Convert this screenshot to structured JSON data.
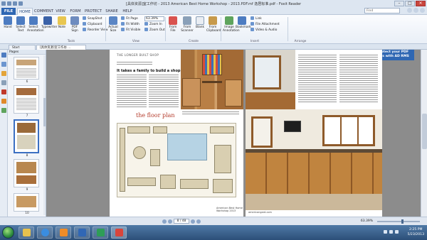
{
  "window": {
    "title": "[具体资源]室工作坊 - 2013 American Best Home Workshop - 2013.PDF.mf 逸居标准.pdf - Foxit Reader"
  },
  "menu": {
    "tabs": [
      "FILE",
      "HOME",
      "COMMENT",
      "VIEW",
      "FORM",
      "PROTECT",
      "SHARE",
      "HELP"
    ],
    "find_placeholder": "Find"
  },
  "ribbon": {
    "buttons": {
      "hand": "Hand",
      "select_text": "Select Text",
      "select_annotation": "Select Annotation",
      "typewriter": "Typewriter",
      "note": "Note",
      "pdf_sign": "PDF Sign",
      "actual_size": "Actual Size",
      "from_file": "From File",
      "from_scanner": "From Scanner",
      "blank": "Blank",
      "from_clipboard": "From Clipboard",
      "image_annotation": "Image Annotation",
      "bookmark": "Bookmark"
    },
    "small": {
      "snapshot": "SnapShot",
      "clipboard": "Clipboard",
      "reorder_view": "Reorder View",
      "fit_page": "Fit Page",
      "fit_width": "Fit Width",
      "fit_visible": "Fit Visible",
      "zoom_in": "Zoom In",
      "zoom_out": "Zoom Out",
      "rotate_left": "Rotate Left",
      "rotate_right": "Rotate Right",
      "link": "Link",
      "file_attachment": "File Attachment",
      "video_audio": "Video & Audio"
    },
    "zoom_value": "63.39%",
    "groups": {
      "tools": "Tools",
      "view": "View",
      "create": "Create",
      "insert": "Insert",
      "arrange": "Arrange"
    }
  },
  "doc_tabs": {
    "start": "Start",
    "active": "[具体资源]室工作坊 ..."
  },
  "pages_panel": {
    "header": "Pages",
    "thumb_numbers": [
      "6",
      "7",
      "8",
      "9",
      "10"
    ]
  },
  "protect_badge": "Protect your PDF files with AD RMS",
  "document": {
    "left_page": {
      "kicker": "THE LONGER BUILT SHOP",
      "headline": "It takes a family to build a shop",
      "section_title": "the floor plan",
      "folio": "American Best Home Workshop 2013"
    },
    "right_page": {
      "folio": "americangard.com"
    }
  },
  "statusbar": {
    "page_display": "8 / 48",
    "zoom_percent": "63.39%"
  },
  "taskbar": {
    "time": "2:25 PM",
    "date": "5/23/2013"
  },
  "colors": {
    "ribbon_accent": "#2f67b3",
    "section_title": "#b43c2c",
    "taskbar": "#2c4f78"
  }
}
